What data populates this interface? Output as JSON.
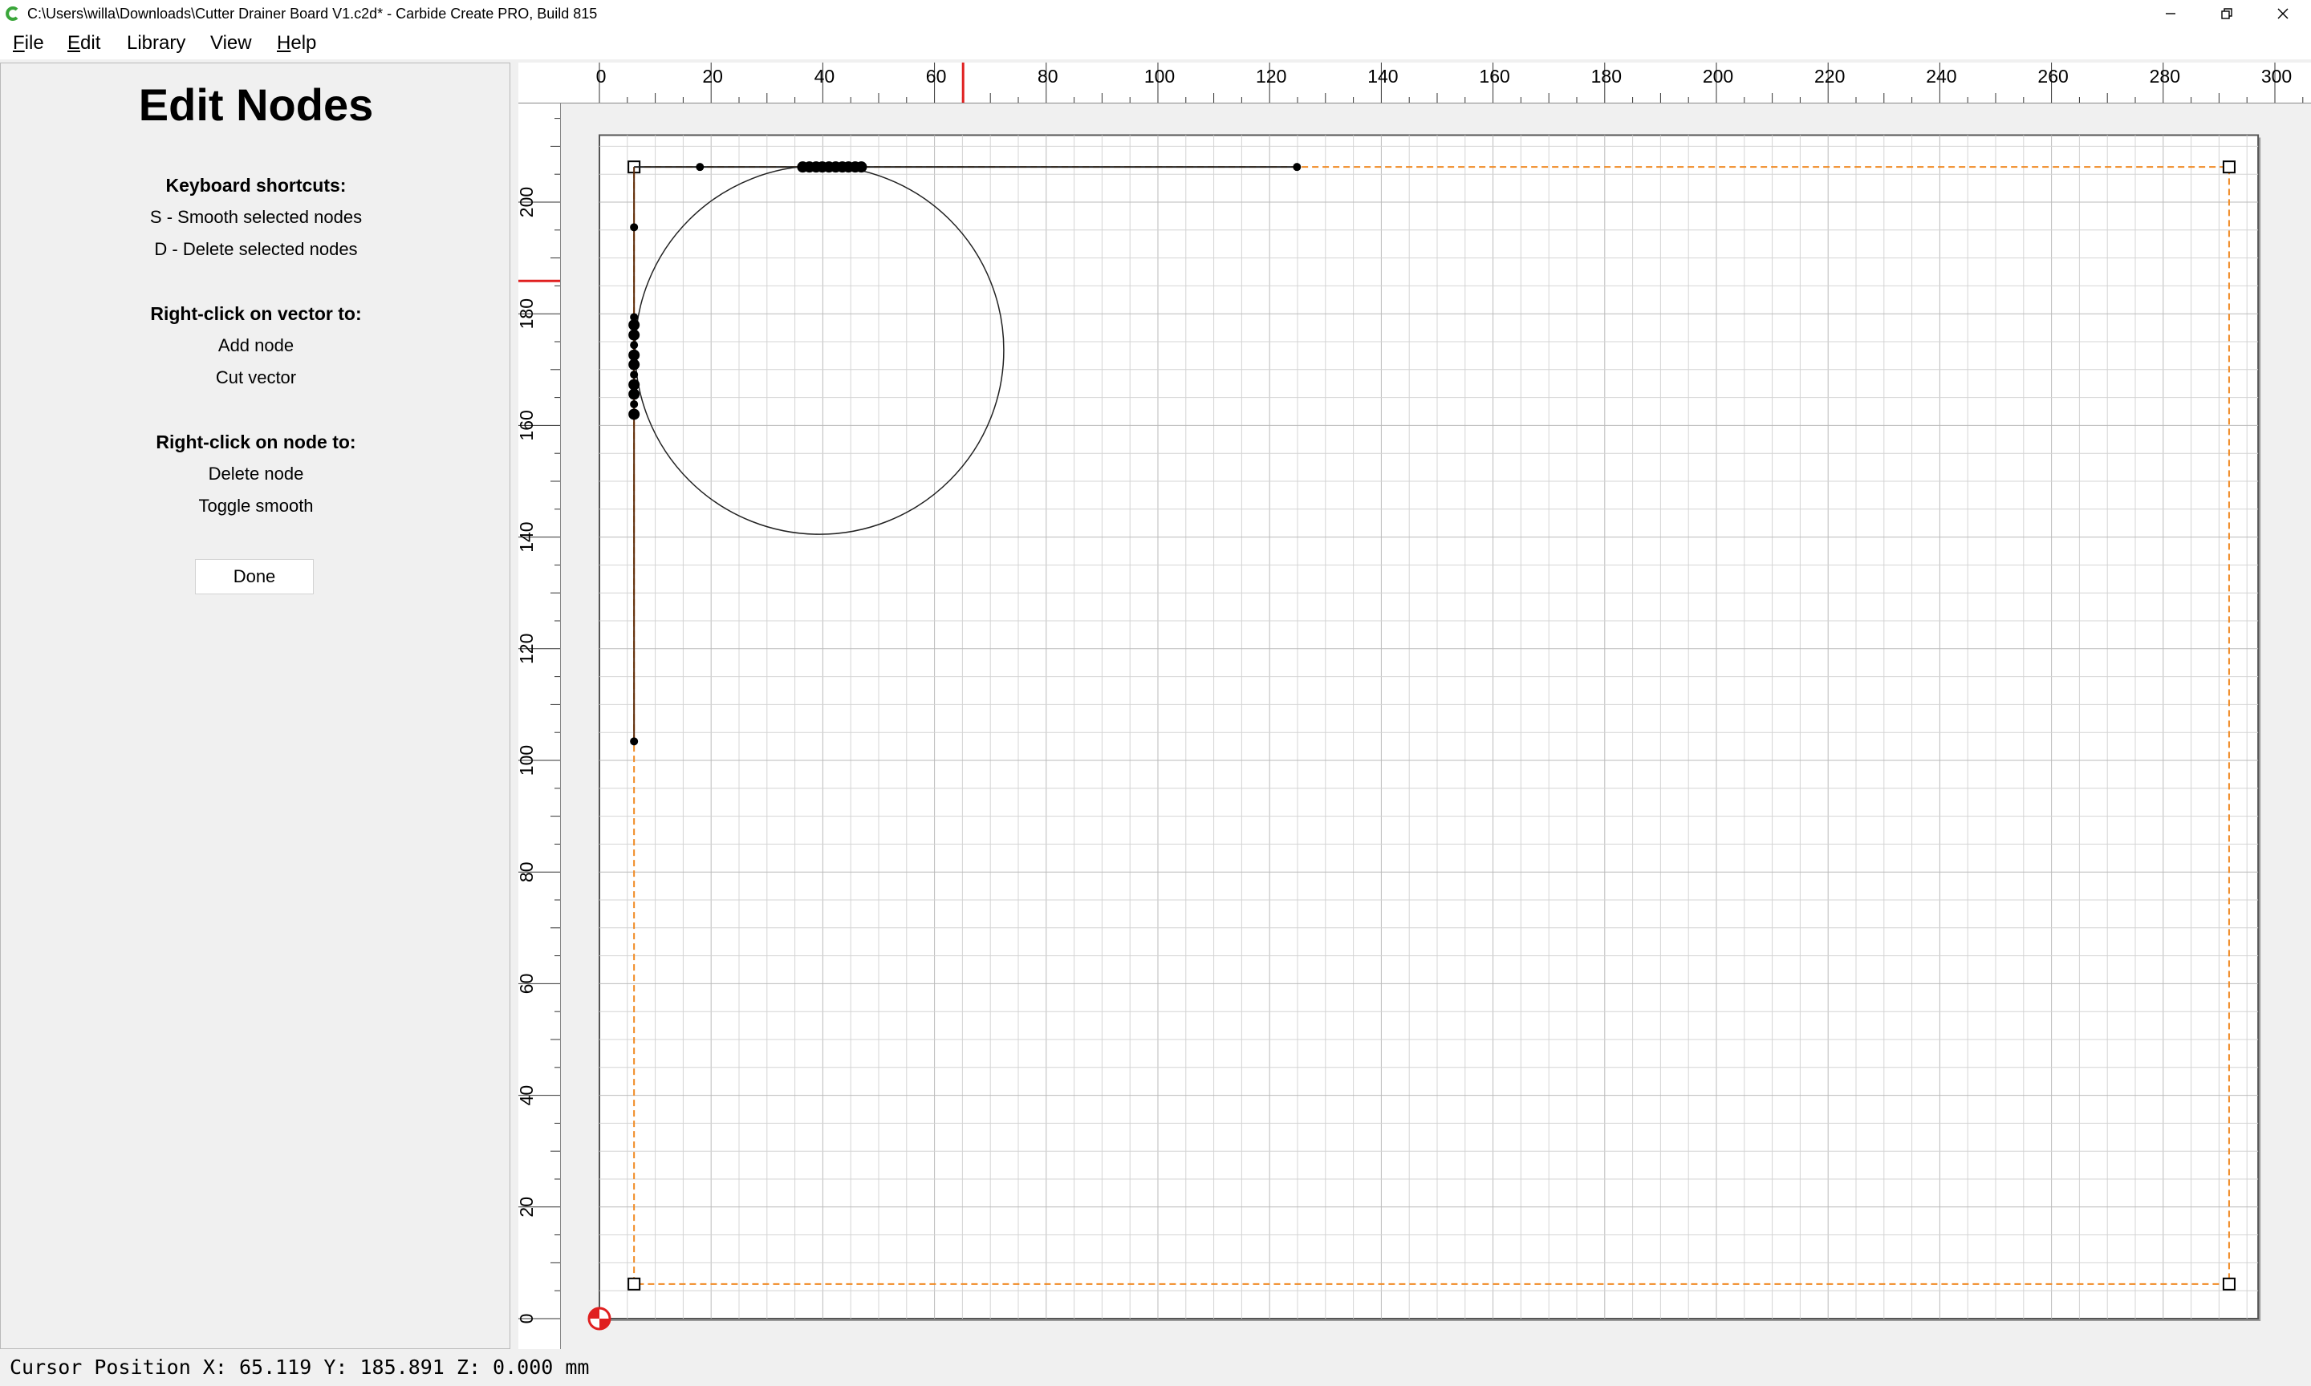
{
  "window": {
    "title": "C:\\Users\\willa\\Downloads\\Cutter Drainer Board  V1.c2d* - Carbide Create PRO, Build 815",
    "app_icon": "carbide-create-c-icon",
    "controls": [
      "minimize-icon",
      "restore-icon",
      "close-icon"
    ]
  },
  "menu": {
    "items": [
      {
        "label": "File",
        "accel": "F",
        "rest": "ile"
      },
      {
        "label": "Edit",
        "accel": "E",
        "rest": "dit"
      },
      {
        "label": "Library",
        "accel": "",
        "rest": "Library"
      },
      {
        "label": "View",
        "accel": "",
        "rest": "View"
      },
      {
        "label": "Help",
        "accel": "H",
        "rest": "elp"
      }
    ]
  },
  "panel": {
    "title": "Edit Nodes",
    "shortcuts_heading": "Keyboard shortcuts:",
    "shortcut_smooth": "S - Smooth selected nodes",
    "shortcut_delete": "D - Delete selected nodes",
    "vector_heading": "Right-click on vector to:",
    "vector_add": "Add node",
    "vector_cut": "Cut vector",
    "node_heading": "Right-click on node to:",
    "node_delete": "Delete node",
    "node_toggle": "Toggle smooth",
    "done_label": "Done"
  },
  "canvas": {
    "units": "mm",
    "x_ticks": [
      "0",
      "20",
      "40",
      "60",
      "80",
      "100",
      "120",
      "140",
      "160",
      "180",
      "200",
      "220",
      "240",
      "260",
      "280",
      "300"
    ],
    "y_ticks": [
      "0",
      "20",
      "40",
      "60",
      "80",
      "100",
      "120",
      "140",
      "160",
      "180",
      "200"
    ],
    "x_tick_values": [
      0,
      20,
      40,
      60,
      80,
      100,
      120,
      140,
      160,
      180,
      200,
      220,
      240,
      260,
      280,
      300
    ],
    "y_tick_values": [
      0,
      20,
      40,
      60,
      80,
      100,
      120,
      140,
      160,
      180,
      200
    ],
    "stock_width": 297,
    "stock_height": 212,
    "cursor_marker": {
      "x": 65.119,
      "y": 185.891
    },
    "grid_spacing": 5,
    "colors": {
      "stock_border": "#555555",
      "selection": "#f08a24",
      "cursor_marker": "#e02020",
      "grid": "#d4d4d4",
      "grid_major": "#bbbbbb",
      "vector": "#222222",
      "origin": "#e02020"
    },
    "selection_box": {
      "x_min": 6.2,
      "x_max": 291.8,
      "y_min": 6.2,
      "y_max": 206.3
    },
    "circle": {
      "cx": 39.4,
      "cy": 173.5,
      "r": 33
    },
    "line_top": {
      "x1": 6.2,
      "x2": 124.9,
      "y": 206.3
    },
    "line_left": {
      "x": 6.2,
      "y1": 103.4,
      "y2": 206.3
    },
    "nodes_top": [
      18.0,
      36.4,
      37.6,
      38.8,
      39.9,
      41.1,
      42.3,
      43.5,
      44.6,
      45.8,
      46.9,
      124.9
    ],
    "nodes_left": [
      103.4,
      195.5,
      179.4,
      178.0,
      176.2,
      174.4,
      172.6,
      170.9,
      169.1,
      167.3,
      165.6,
      163.8,
      162.0
    ],
    "origin_icon": "origin-target-icon"
  },
  "status": {
    "cursor_position": "Cursor Position X: 65.119 Y: 185.891 Z: 0.000 mm"
  }
}
